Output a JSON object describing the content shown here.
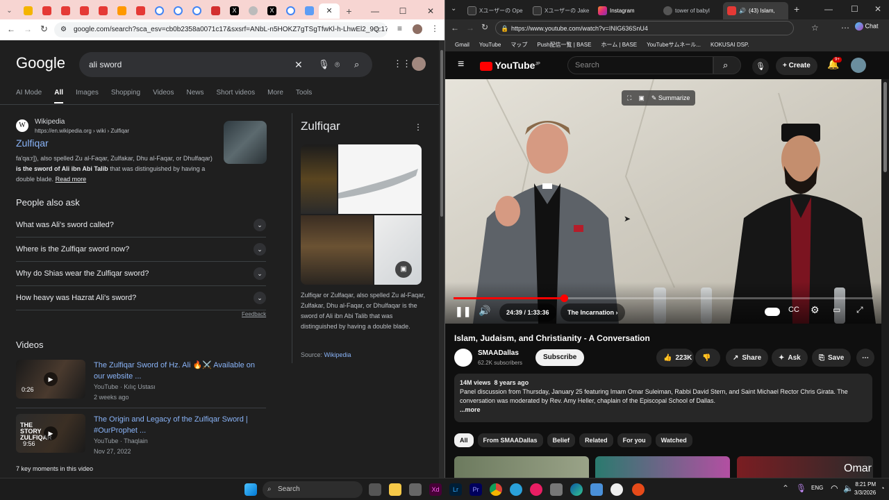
{
  "left_window": {
    "omnibox_url": "google.com/search?sca_esv=cb0b2358a0071c17&sxsrf=ANbL-n5HOKZ7gTSgTfwKl-h-LhwEl2_9Q:17...",
    "google": {
      "logo": "Google",
      "query": "ali sword",
      "tabs": [
        "AI Mode",
        "All",
        "Images",
        "Shopping",
        "Videos",
        "News",
        "Short videos",
        "More",
        "Tools"
      ],
      "result": {
        "source": "Wikipedia",
        "url": "https://en.wikipedia.org › wiki › Zulfiqar",
        "title": "Zulfiqar",
        "snippet_start": "fa'qa:r]), also spelled Zu al-Faqar, Zulfakar, Dhu al-Faqar, or Dhulfaqar)",
        "snippet_bold": "is the sword of Ali ibn Abi Talib",
        "snippet_end": "that was distinguished by having a double blade.",
        "read_more": "Read more"
      },
      "people_also_ask": {
        "heading": "People also ask",
        "questions": [
          "What was Ali's sword called?",
          "Where is the Zulfiqar sword now?",
          "Why do Shias wear the Zulfiqar sword?",
          "How heavy was Hazrat Ali's sword?"
        ],
        "feedback": "Feedback"
      },
      "videos": {
        "heading": "Videos",
        "items": [
          {
            "title": "The Zulfiqar Sword of Hz. Ali 🔥⚔️ Available on our website ...",
            "channel": "YouTube · Kılıç Ustası",
            "date": "2 weeks ago",
            "duration": "0:26"
          },
          {
            "title": "The Origin and Legacy of the Zulfiqar Sword | #OurProphet ...",
            "channel": "YouTube · Thaqlain",
            "date": "Nov 27, 2022",
            "duration": "9:56",
            "thumb_text": "THE STORY ZULFIQAR"
          }
        ],
        "key_moments": "7 key moments in this video"
      },
      "knowledge_panel": {
        "title": "Zulfiqar",
        "description": "Zulfiqar or Zulfaqar, also spelled Zu al-Faqar, Zulfakar, Dhu al-Faqar, or Dhulfaqar is the sword of Ali ibn Abi Talib that was distinguished by having a double blade.",
        "source_label": "Source:",
        "source_link": "Wikipedia"
      }
    }
  },
  "right_window": {
    "tabs": [
      "Xユーザーの Ope",
      "Xユーザーの Jake",
      "Instagram",
      "tower of babyl",
      "(43) Islam,"
    ],
    "omnibox_url": "https://www.youtube.com/watch?v=INIG636SnU4",
    "copilot_label": "Chat",
    "bookmarks": [
      "Gmail",
      "YouTube",
      "マップ",
      "Push配信一覧 | BASE",
      "ホーム | BASE",
      "YouTubeサムネール...",
      "KOKUSAI DSP."
    ],
    "youtube": {
      "logo": "YouTube",
      "logo_region": "JP",
      "search_placeholder": "Search",
      "create": "Create",
      "notif_count": "9+",
      "summarize": "Summarize",
      "time": "24:39 / 1:33:36",
      "chapter": "The Incarnation",
      "progress_pct": 26.3,
      "video_title": "Islam, Judaism, and Christianity - A Conversation",
      "channel": "SMAADallas",
      "subscribers": "62.2K subscribers",
      "subscribe": "Subscribe",
      "likes": "223K",
      "share": "Share",
      "ask": "Ask",
      "save": "Save",
      "views": "14M views",
      "age": "8 years ago",
      "description": "Panel discussion from Thursday, January 25 featuring Imam Omar Suleiman, Rabbi David Stern, and Saint Michael Rector Chris Girata. The conversation was moderated by Rev. Amy Heller, chaplain of the Episcopal School of Dallas.",
      "more": "...more",
      "chips": [
        "All",
        "From SMAADallas",
        "Belief",
        "Related",
        "For you",
        "Watched"
      ],
      "overlay_name": "Omar"
    }
  },
  "taskbar": {
    "search": "Search",
    "language": "ENG",
    "time": "8:21 PM",
    "date": "3/3/2026"
  }
}
